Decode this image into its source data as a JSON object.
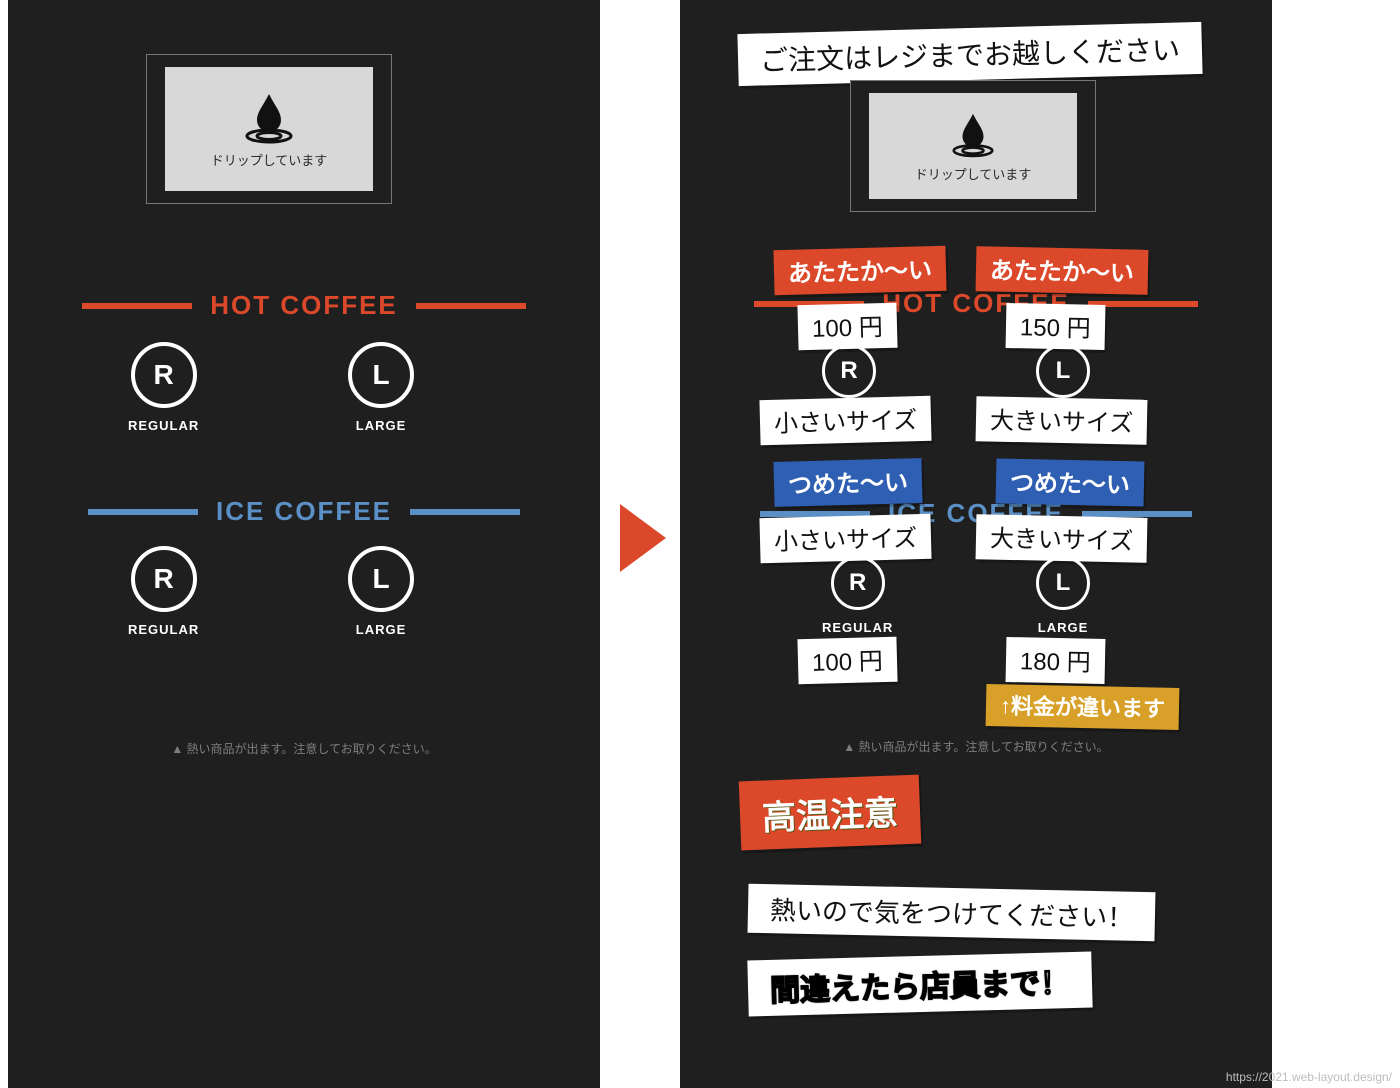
{
  "colors": {
    "hot": "#db482a",
    "ice": "#5a90c6",
    "yellow": "#d8a028",
    "blue": "#2f5fb3"
  },
  "drip_text": "ドリップしています",
  "left": {
    "hot_title": "HOT COFFEE",
    "ice_title": "ICE COFFEE",
    "sizes": {
      "r_letter": "R",
      "r_label": "REGULAR",
      "l_letter": "L",
      "l_label": "LARGE"
    },
    "caution": "▲ 熱い商品が出ます。注意してお取りください。"
  },
  "right": {
    "top_notice": "ご注文はレジまでお越しください",
    "hot_title": "HOT COFFEE",
    "ice_title": "ICE COFFEE",
    "hot_temp": "あたたか～い",
    "hot_price_r": "100 円",
    "hot_price_l": "150 円",
    "hot_size_r": "小さいサイズ",
    "hot_size_l": "大きいサイズ",
    "ice_temp": "つめた～い",
    "ice_size_r": "小さいサイズ",
    "ice_size_l": "大きいサイズ",
    "ice_price_r": "100 円",
    "ice_price_l": "180 円",
    "price_differs": "↑料金が違います",
    "sizes": {
      "r_letter": "R",
      "r_label": "REGULAR",
      "l_letter": "L",
      "l_label": "LARGE"
    },
    "caution": "▲ 熱い商品が出ます。注意してお取りください。",
    "high_temp": "高温注意",
    "careful": "熱いので気をつけてください！",
    "mistake": "間違えたら店員まで！"
  },
  "watermark": "https://2021.web-layout.design/"
}
